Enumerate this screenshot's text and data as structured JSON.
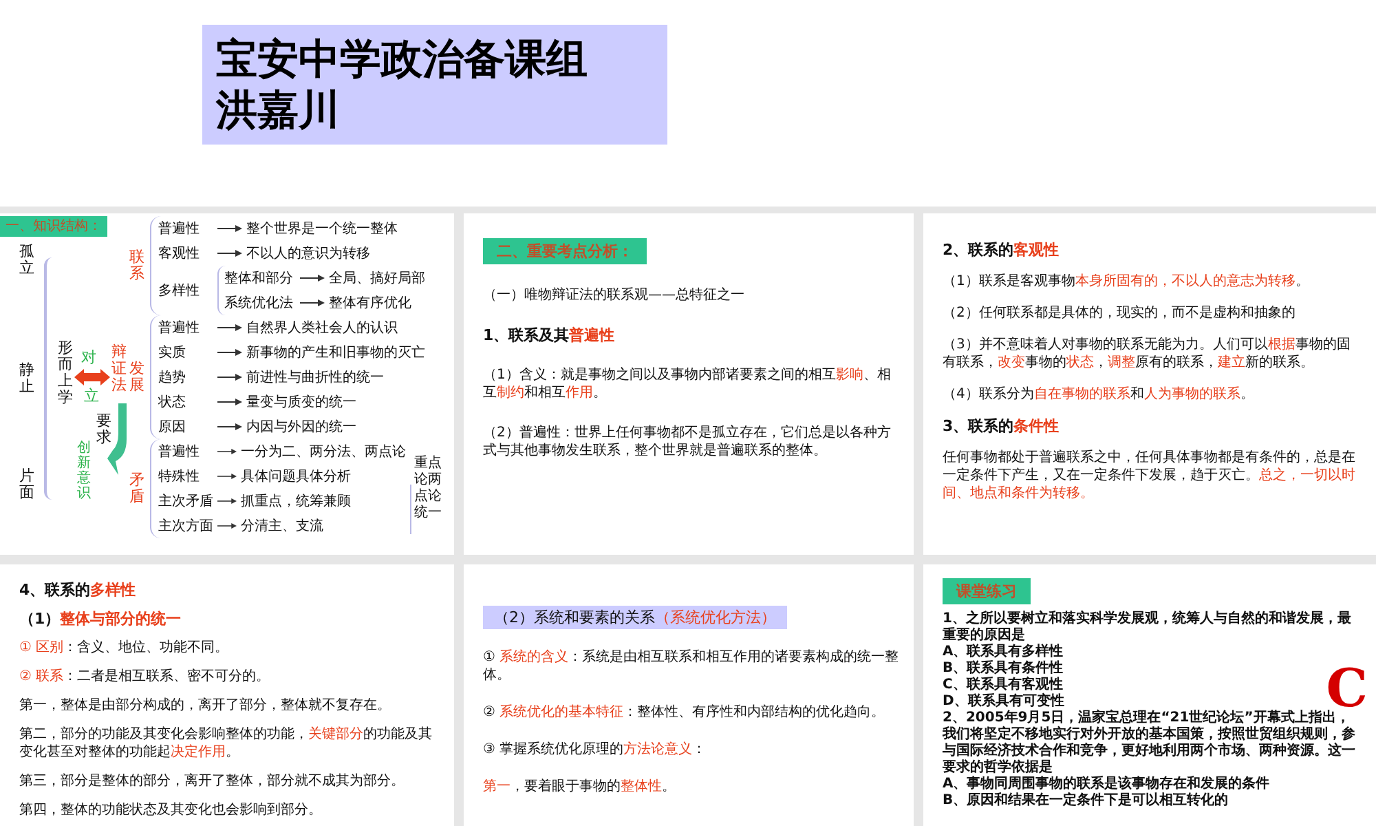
{
  "header": {
    "title_lines": [
      "宝安中学政治备课组",
      "洪嘉川"
    ]
  },
  "slides": [
    {
      "kind": "mindmap",
      "heading": "一、知识结构：",
      "left_terms": [
        "孤立",
        "静止",
        "片面"
      ],
      "metaphysics": "形而上学",
      "opposition": [
        "对",
        "立"
      ],
      "dialectics": "辩证法",
      "requirement": "要求",
      "innovation": "创新意识",
      "branches": [
        {
          "label": "联系",
          "items": [
            {
              "term": "普遍性",
              "desc": "整个世界是一个统一整体"
            },
            {
              "term": "客观性",
              "desc": "不以人的意识为转移"
            },
            {
              "term": "多样性",
              "children": [
                {
                  "term": "整体和部分",
                  "desc": "全局、搞好局部"
                },
                {
                  "term": "系统优化法",
                  "desc": "整体有序优化"
                }
              ]
            }
          ]
        },
        {
          "label": "发展",
          "items": [
            {
              "term": "普遍性",
              "desc": "自然界人类社会人的认识"
            },
            {
              "term": "实质",
              "desc": "新事物的产生和旧事物的灭亡"
            },
            {
              "term": "趋势",
              "desc": "前进性与曲折性的统一"
            },
            {
              "term": "状态",
              "desc": "量变与质变的统一"
            },
            {
              "term": "原因",
              "desc": "内因与外因的统一"
            }
          ]
        },
        {
          "label": "矛盾",
          "items": [
            {
              "term": "普遍性",
              "desc": "一分为二、两分法、两点论"
            },
            {
              "term": "特殊性",
              "desc": "具体问题具体分析"
            },
            {
              "term": "主次矛盾",
              "desc": "抓重点，统筹兼顾"
            },
            {
              "term": "主次方面",
              "desc": "分清主、支流"
            }
          ],
          "note": "重点论两点论统一"
        }
      ]
    },
    {
      "kind": "text",
      "blocks": [
        {
          "kind": "tag",
          "segments": [
            {
              "text": "二、重要考点分析：",
              "emphasis": false
            }
          ]
        },
        {
          "kind": "paragraph",
          "segments": [
            {
              "text": "（一）唯物辩证法的联系观——总特征之一",
              "emphasis": false
            }
          ]
        },
        {
          "kind": "heading",
          "segments": [
            {
              "text": "1、联系及其",
              "emphasis": false
            },
            {
              "text": "普遍性",
              "emphasis": true
            }
          ]
        },
        {
          "kind": "paragraph",
          "segments": [
            {
              "text": "（1）含义：就是事物之间以及事物内部诸要素之间的相互",
              "emphasis": false
            },
            {
              "text": "影响",
              "emphasis": true
            },
            {
              "text": "、相互",
              "emphasis": false
            },
            {
              "text": "制约",
              "emphasis": true
            },
            {
              "text": "和相互",
              "emphasis": false
            },
            {
              "text": "作用",
              "emphasis": true
            },
            {
              "text": "。",
              "emphasis": false
            }
          ]
        },
        {
          "kind": "paragraph",
          "segments": [
            {
              "text": "（2）普遍性：世界上任何事物都不是孤立存在，它们总是以各种方式与其他事物发生联系，整个世界就是普遍联系的整体。",
              "emphasis": false
            }
          ]
        }
      ]
    },
    {
      "kind": "text",
      "blocks": [
        {
          "kind": "heading",
          "segments": [
            {
              "text": "2、联系的",
              "emphasis": false
            },
            {
              "text": "客观性",
              "emphasis": true
            }
          ]
        },
        {
          "kind": "paragraph",
          "segments": [
            {
              "text": "（1）联系是客观事物",
              "emphasis": false
            },
            {
              "text": "本身所固有的，不以人的意志为转移",
              "emphasis": true
            },
            {
              "text": "。",
              "emphasis": false
            }
          ]
        },
        {
          "kind": "paragraph",
          "segments": [
            {
              "text": "（2）任何联系都是具体的，现实的，而不是虚构和抽象的",
              "emphasis": false
            }
          ]
        },
        {
          "kind": "paragraph",
          "segments": [
            {
              "text": "（3）并不意味着人对事物的联系无能为力。人们可以",
              "emphasis": false
            },
            {
              "text": "根据",
              "emphasis": true
            },
            {
              "text": "事物的固有联系，",
              "emphasis": false
            },
            {
              "text": "改变",
              "emphasis": true
            },
            {
              "text": "事物的",
              "emphasis": false
            },
            {
              "text": "状态",
              "emphasis": true
            },
            {
              "text": "，",
              "emphasis": false
            },
            {
              "text": "调整",
              "emphasis": true
            },
            {
              "text": "原有的联系，",
              "emphasis": false
            },
            {
              "text": "建立",
              "emphasis": true
            },
            {
              "text": "新的联系。",
              "emphasis": false
            }
          ]
        },
        {
          "kind": "paragraph",
          "segments": [
            {
              "text": "（4）联系分为",
              "emphasis": false
            },
            {
              "text": "自在事物的联系",
              "emphasis": true
            },
            {
              "text": "和",
              "emphasis": false
            },
            {
              "text": "人为事物的联系",
              "emphasis": true
            },
            {
              "text": "。",
              "emphasis": false
            }
          ]
        },
        {
          "kind": "heading",
          "segments": [
            {
              "text": "3、联系的",
              "emphasis": false
            },
            {
              "text": "条件性",
              "emphasis": true
            }
          ]
        },
        {
          "kind": "paragraph",
          "segments": [
            {
              "text": "任何事物都处于普遍联系之中，任何具体事物都是有条件的，总是在一定条件下产生，又在一定条件下发展，趋于灭亡。",
              "emphasis": false
            },
            {
              "text": "总之，一切以时间、地点和条件为转移。",
              "emphasis": true
            }
          ]
        }
      ]
    },
    {
      "kind": "text",
      "blocks": [
        {
          "kind": "heading",
          "segments": [
            {
              "text": "4、联系的",
              "emphasis": false
            },
            {
              "text": "多样性",
              "emphasis": true
            }
          ]
        },
        {
          "kind": "heading",
          "segments": [
            {
              "text": "（1）",
              "emphasis": false
            },
            {
              "text": "整体与部分的统一",
              "emphasis": true
            }
          ]
        },
        {
          "kind": "paragraph",
          "segments": [
            {
              "text": "① 区别",
              "emphasis": true
            },
            {
              "text": "：含义、地位、功能不同。",
              "emphasis": false
            }
          ]
        },
        {
          "kind": "paragraph",
          "segments": [
            {
              "text": "② 联系",
              "emphasis": true
            },
            {
              "text": "：二者是相互联系、密不可分的。",
              "emphasis": false
            }
          ]
        },
        {
          "kind": "paragraph",
          "segments": [
            {
              "text": "第一，整体是由部分构成的，离开了部分，整体就不复存在。",
              "emphasis": false
            }
          ]
        },
        {
          "kind": "paragraph",
          "segments": [
            {
              "text": "第二，部分的功能及其变化会影响整体的功能，",
              "emphasis": false
            },
            {
              "text": "关键部分",
              "emphasis": true
            },
            {
              "text": "的功能及其变化甚至对整体的功能起",
              "emphasis": false
            },
            {
              "text": "决定作用",
              "emphasis": true
            },
            {
              "text": "。",
              "emphasis": false
            }
          ]
        },
        {
          "kind": "paragraph",
          "segments": [
            {
              "text": "第三，部分是整体的部分，离开了整体，部分就不成其为部分。",
              "emphasis": false
            }
          ]
        },
        {
          "kind": "paragraph",
          "segments": [
            {
              "text": "第四，整体的功能状态及其变化也会影响到部分。",
              "emphasis": false
            }
          ]
        }
      ]
    },
    {
      "kind": "text",
      "blocks": [
        {
          "kind": "banner",
          "segments": [
            {
              "text": "（2）系统和要素的关系",
              "emphasis": false
            },
            {
              "text": "（系统优化方法）",
              "emphasis": true
            }
          ]
        },
        {
          "kind": "paragraph",
          "segments": [
            {
              "text": "① ",
              "emphasis": false
            },
            {
              "text": "系统的含义",
              "emphasis": true
            },
            {
              "text": "：系统是由相互联系和相互作用的诸要素构成的统一整体。",
              "emphasis": false
            }
          ]
        },
        {
          "kind": "paragraph",
          "segments": [
            {
              "text": "② ",
              "emphasis": false
            },
            {
              "text": "系统优化的基本特征",
              "emphasis": true
            },
            {
              "text": "：整体性、有序性和内部结构的优化趋向。",
              "emphasis": false
            }
          ]
        },
        {
          "kind": "paragraph",
          "segments": [
            {
              "text": "③ 掌握系统优化原理的",
              "emphasis": false
            },
            {
              "text": "方法论意义",
              "emphasis": true
            },
            {
              "text": "：",
              "emphasis": false
            }
          ]
        },
        {
          "kind": "paragraph",
          "segments": [
            {
              "text": "第一",
              "emphasis": true
            },
            {
              "text": "，要着眼于事物的",
              "emphasis": false
            },
            {
              "text": "整体性",
              "emphasis": true
            },
            {
              "text": "。",
              "emphasis": false
            }
          ]
        }
      ]
    },
    {
      "kind": "text",
      "answer": "C",
      "blocks": [
        {
          "kind": "tag",
          "segments": [
            {
              "text": "课堂练习",
              "emphasis": false
            }
          ]
        },
        {
          "kind": "question",
          "segments": [
            {
              "text": "1、之所以要树立和落实科学发展观，统筹人与自然的和谐发展，最重要的原因是",
              "emphasis": false
            }
          ]
        },
        {
          "kind": "option",
          "segments": [
            {
              "text": "A、联系具有多样性",
              "emphasis": false
            }
          ]
        },
        {
          "kind": "option",
          "segments": [
            {
              "text": "B、联系具有条件性",
              "emphasis": false
            }
          ]
        },
        {
          "kind": "option",
          "segments": [
            {
              "text": "C、联系具有客观性",
              "emphasis": false
            }
          ]
        },
        {
          "kind": "option",
          "segments": [
            {
              "text": "D、联系具有可变性",
              "emphasis": false
            }
          ]
        },
        {
          "kind": "question",
          "segments": [
            {
              "text": "2、2005年9月5日，温家宝总理在“21世纪论坛”开幕式上指出，我们将坚定不移地实行对外开放的基本国策，按照世贸组织规则，参与国际经济技术合作和竞争，更好地利用两个市场、两种资源。这一要求的哲学依据是",
              "emphasis": false
            }
          ]
        },
        {
          "kind": "option",
          "segments": [
            {
              "text": "A、事物同周围事物的联系是该事物存在和发展的条件",
              "emphasis": false
            }
          ]
        },
        {
          "kind": "option",
          "segments": [
            {
              "text": "B、原因和结果在一定条件下是可以相互转化的",
              "emphasis": false
            }
          ]
        }
      ]
    }
  ]
}
